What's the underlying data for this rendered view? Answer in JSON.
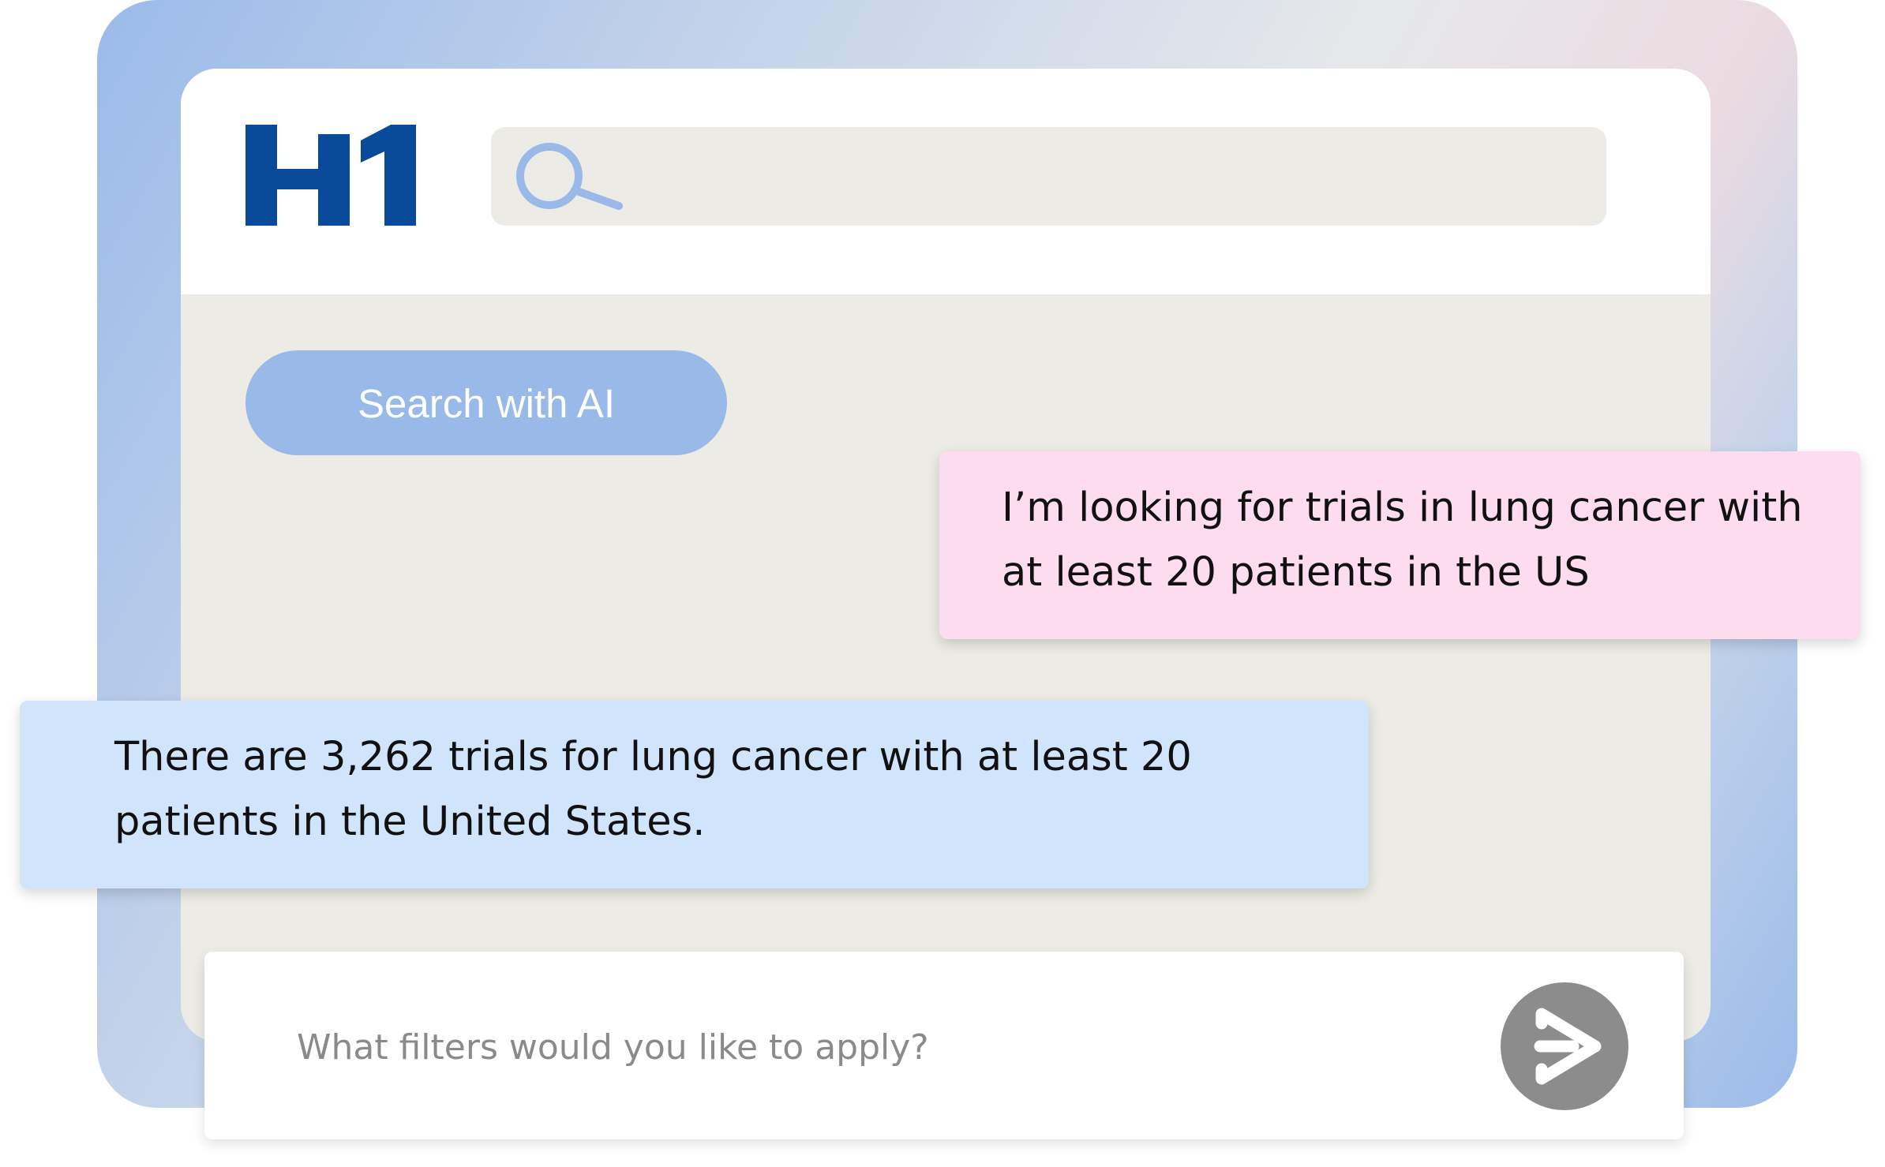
{
  "colors": {
    "brand_blue": "#0a4a9b",
    "ai_button": "#99b9e9",
    "user_bubble": "#fcdcee",
    "ai_bubble": "#d0e4fb",
    "panel_bg": "#ecebe5",
    "send_button": "#8c8c8c"
  },
  "header": {
    "logo_icon": "h1-logo",
    "search_icon": "search-icon"
  },
  "ai_button": {
    "label": "Search with AI"
  },
  "messages": [
    {
      "role": "user",
      "text": "I’m looking for trials in lung cancer with at least 20 patients in the US"
    },
    {
      "role": "assistant",
      "text": "There are 3,262 trials for lung cancer with at least 20 patients in the United States."
    }
  ],
  "chat_input": {
    "placeholder": "What filters would you like to apply?",
    "value": "",
    "send_icon": "send-arrow-icon"
  }
}
